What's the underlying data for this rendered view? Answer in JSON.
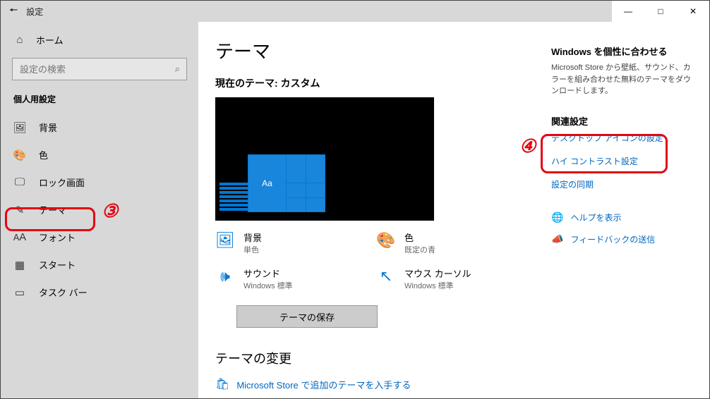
{
  "window": {
    "title": "設定",
    "controls": {
      "minimize": "—",
      "maximize": "□",
      "close": "✕"
    }
  },
  "sidebar": {
    "home": "ホーム",
    "search_placeholder": "設定の検索",
    "section": "個人用設定",
    "items": [
      {
        "icon": "image-icon",
        "label": "背景"
      },
      {
        "icon": "palette-icon",
        "label": "色"
      },
      {
        "icon": "lock-screen-icon",
        "label": "ロック画面"
      },
      {
        "icon": "theme-icon",
        "label": "テーマ"
      },
      {
        "icon": "font-icon",
        "label": "フォント"
      },
      {
        "icon": "start-icon",
        "label": "スタート"
      },
      {
        "icon": "taskbar-icon",
        "label": "タスク バー"
      }
    ]
  },
  "main": {
    "h1": "テーマ",
    "current": "現在のテーマ: カスタム",
    "preview_tile_text": "Aa",
    "settings": {
      "background": {
        "label": "背景",
        "value": "単色"
      },
      "color": {
        "label": "色",
        "value": "既定の青"
      },
      "sound": {
        "label": "サウンド",
        "value": "Windows 標準"
      },
      "cursor": {
        "label": "マウス カーソル",
        "value": "Windows 標準"
      }
    },
    "save_button": "テーマの保存",
    "change_theme_h": "テーマの変更",
    "store_link": "Microsoft Store で追加のテーマを入手する"
  },
  "side": {
    "personalize_h": "Windows を個性に合わせる",
    "personalize_p": "Microsoft Store から壁紙、サウンド、カラーを組み合わせた無料のテーマをダウンロードします。",
    "related_h": "関連設定",
    "desktop_icons": "デスクトップ アイコンの設定",
    "high_contrast": "ハイ コントラスト設定",
    "sync": "設定の同期",
    "help": "ヘルプを表示",
    "feedback": "フィードバックの送信"
  },
  "annotations": {
    "n3": "③",
    "n4": "④"
  }
}
